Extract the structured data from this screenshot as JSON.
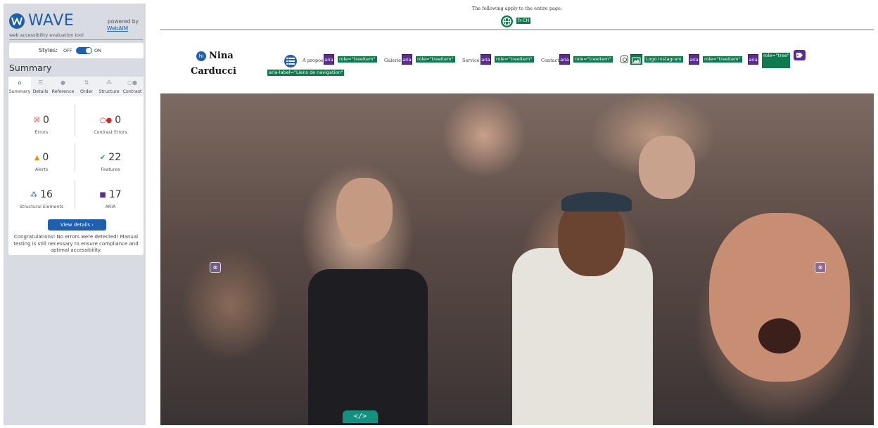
{
  "wave": {
    "logo_text": "WAVE",
    "subtitle": "web accessibility evaluation tool",
    "powered_by": "powered by",
    "webaim_link": "WebAIM",
    "styles_label": "Styles:",
    "styles_off": "OFF",
    "styles_on": "ON",
    "styles_enabled": true,
    "summary_heading": "Summary",
    "tabs": [
      {
        "label": "Summary",
        "icon": "home-icon"
      },
      {
        "label": "Details",
        "icon": "list-icon"
      },
      {
        "label": "Reference",
        "icon": "info-icon"
      },
      {
        "label": "Order",
        "icon": "order-icon"
      },
      {
        "label": "Structure",
        "icon": "structure-icon"
      },
      {
        "label": "Contrast",
        "icon": "contrast-icon"
      }
    ],
    "active_tab": "Summary",
    "stats": {
      "errors": {
        "value": "0",
        "label": "Errors",
        "color": "#d52b1e"
      },
      "contrast_errors": {
        "value": "0",
        "label": "Contrast Errors",
        "color": "#d52b1e"
      },
      "alerts": {
        "value": "0",
        "label": "Alerts",
        "color": "#e8951e"
      },
      "features": {
        "value": "22",
        "label": "Features",
        "color": "#2e9c4f"
      },
      "structural": {
        "value": "16",
        "label": "Structural Elements",
        "color": "#1e5fae"
      },
      "aria": {
        "value": "17",
        "label": "ARIA",
        "color": "#5c2d91"
      }
    },
    "view_details": "View details ›",
    "congrats": "Congratulations! No errors were detected! Manual testing is still necessary to ensure compliance and optimal accessibility."
  },
  "page": {
    "global_note": "The following apply to the entire page:",
    "lang_tag": "fr-CH",
    "brand_first": "Nina",
    "brand_last": "Carducci",
    "brand_icon": "hi",
    "nav": [
      {
        "label": "À propos",
        "role_tag": "role=\"treeitem\""
      },
      {
        "label": "Galerie",
        "role_tag": "role=\"treeitem\""
      },
      {
        "label": "Service",
        "role_tag": "role=\"treeitem\""
      },
      {
        "label": "Contact",
        "role_tag": "role=\"treeitem\""
      }
    ],
    "aria_text": "aria",
    "insta_alt_tag": "Logo instagram",
    "insta_role_tag": "role=\"treeitem\"",
    "tree_role_tag": "role=\"tree\"",
    "nav_label_tag": "aria-label=\"Liens de navigation\"",
    "code_toggle": "</>"
  },
  "colors": {
    "wave_blue": "#1e5fae",
    "feature_green": "#0f7a4d",
    "aria_purple": "#5c2d91",
    "sidebar_bg": "#d8dbe2"
  }
}
